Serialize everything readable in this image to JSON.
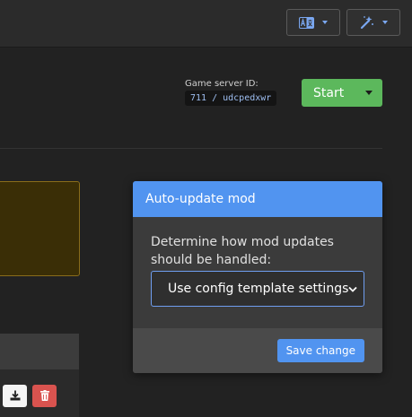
{
  "toolbar": {
    "translate_icon": "translate-icon",
    "magic_wand_icon": "magic-wand-icon"
  },
  "server": {
    "label": "Game server ID:",
    "id": "711 / udcpedxwr"
  },
  "start_button": {
    "label": "Start"
  },
  "modal": {
    "title": "Auto-update mod",
    "description": "Determine how mod updates should be handled:",
    "select_value": "Use config template settings",
    "save_label": "Save change"
  },
  "actions": {
    "download_icon": "download-icon",
    "delete_icon": "trash-icon"
  },
  "colors": {
    "accent": "#5194f0",
    "success": "#5cb85c",
    "danger": "#d9534f",
    "warning_bg": "#3a2e06"
  }
}
